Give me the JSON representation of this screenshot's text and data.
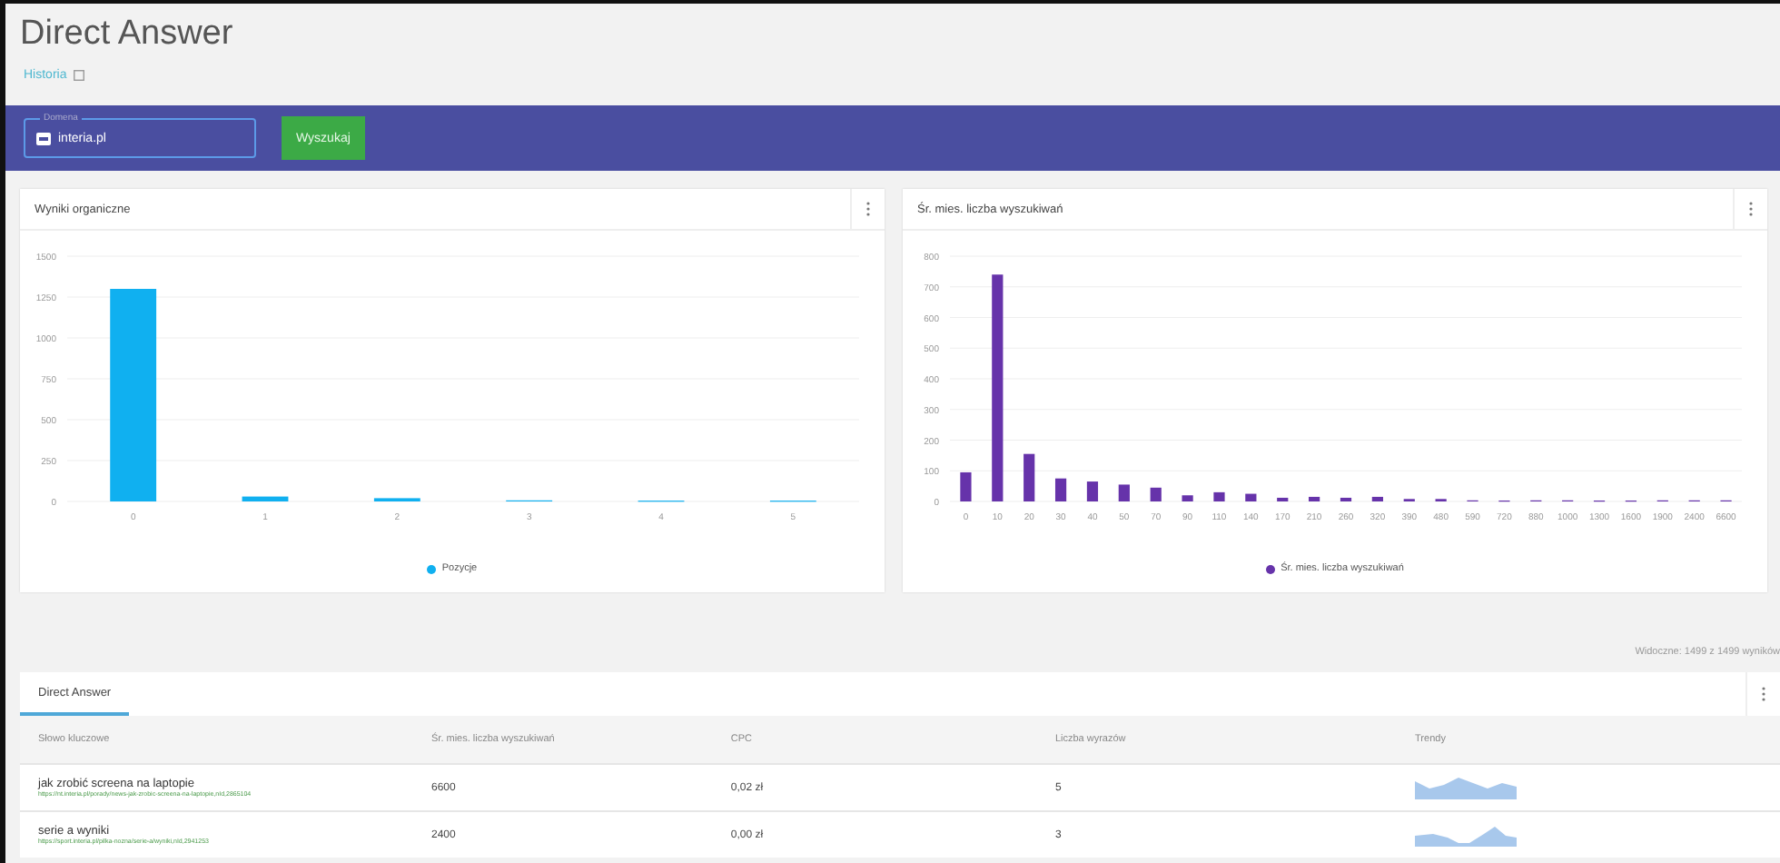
{
  "page": {
    "title": "Direct Answer",
    "history_link": "Historia"
  },
  "search_bar": {
    "domain_field": {
      "label": "Domena",
      "value": "interia.pl"
    },
    "search_button": "Wyszukaj"
  },
  "charts": [
    {
      "title": "Wyniki organiczne",
      "chart_data": {
        "type": "bar",
        "categories": [
          "0",
          "1",
          "2",
          "3",
          "4",
          "5"
        ],
        "series": [
          {
            "name": "Pozycje",
            "color": "#10b0f0",
            "values": [
              1300,
              30,
              20,
              0,
              5,
              5
            ]
          }
        ],
        "ylim": [
          0,
          1500
        ],
        "grid": true,
        "yticks": [
          0,
          250,
          500,
          750,
          1000,
          1250,
          1500
        ]
      }
    },
    {
      "title": "Śr. mies. liczba wyszukiwań",
      "chart_data": {
        "type": "bar",
        "categories": [
          "0",
          "10",
          "20",
          "30",
          "40",
          "50",
          "70",
          "90",
          "110",
          "140",
          "170",
          "210",
          "260",
          "320",
          "390",
          "480",
          "590",
          "720",
          "880",
          "1000",
          "1300",
          "1600",
          "1900",
          "2400",
          "6600"
        ],
        "series": [
          {
            "name": "Śr. mies. liczba wyszukiwań",
            "color": "#6633aa",
            "values": [
              95,
              740,
              155,
              75,
              65,
              55,
              45,
              20,
              30,
              25,
              12,
              15,
              12,
              15,
              8,
              8,
              0,
              3,
              0,
              0,
              3,
              3,
              0,
              0,
              0
            ]
          }
        ],
        "ylim": [
          0,
          800
        ],
        "grid": true,
        "yticks": [
          0,
          100,
          200,
          300,
          400,
          500,
          600,
          700,
          800
        ]
      }
    }
  ],
  "results_count": "Widoczne: 1499 z 1499 wyników",
  "tabs": [
    {
      "label": "Direct Answer",
      "selected": true
    }
  ],
  "table": {
    "columns": [
      "Słowo kluczowe",
      "Śr. mies. liczba wyszukiwań",
      "CPC",
      "Liczba wyrazów",
      "Trendy"
    ],
    "rows": [
      {
        "keyword": "jak zrobić screena na laptopie",
        "url": "https://nt.interia.pl/porady/news-jak-zrobic-screena-na-laptopie,nId,2865104",
        "searches": "6600",
        "cpc": "0,02 zł",
        "words": "5"
      },
      {
        "keyword": "serie a wyniki",
        "url": "https://sport.interia.pl/pilka-nozna/serie-a/wyniki,nId,2941253",
        "searches": "2400",
        "cpc": "0,00 zł",
        "words": "3"
      }
    ]
  }
}
